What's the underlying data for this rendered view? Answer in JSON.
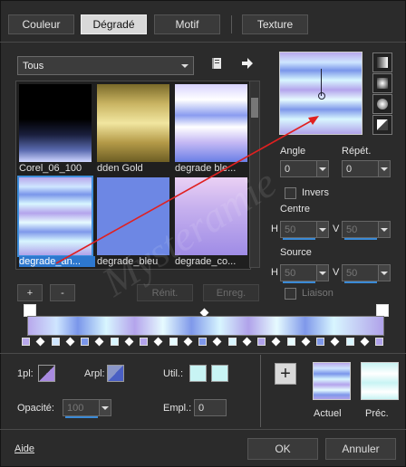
{
  "tabs": [
    "Couleur",
    "Dégradé",
    "Motif",
    "Texture"
  ],
  "active_tab": 1,
  "filter_value": "Tous",
  "thumbnails": [
    {
      "label": "Corel_06_100"
    },
    {
      "label": "dden Gold"
    },
    {
      "label": "degrade ble..."
    },
    {
      "label": "degrade_an..."
    },
    {
      "label": "degrade_bleu"
    },
    {
      "label": "degrade_co..."
    }
  ],
  "selected_thumbnail": "degrade_an...",
  "buttons": {
    "add": "+",
    "remove": "-",
    "reset": "Rénit.",
    "save": "Enreg.",
    "ok": "OK",
    "cancel": "Annuler",
    "help": "Aide"
  },
  "angle": {
    "label": "Angle",
    "value": "0"
  },
  "repeat": {
    "label": "Répét.",
    "value": "0"
  },
  "invert": {
    "label": "Invers",
    "checked": false
  },
  "center": {
    "label": "Centre",
    "h_label": "H",
    "h_value": "50",
    "v_label": "V",
    "v_value": "50"
  },
  "source": {
    "label": "Source",
    "h_label": "H",
    "h_value": "50",
    "v_label": "V",
    "v_value": "50"
  },
  "link": {
    "label": "Liaison",
    "checked": false
  },
  "opacity": {
    "label": "Opacité:",
    "value": "100"
  },
  "location": {
    "label": "Empl.:",
    "value": "0"
  },
  "color_labels": {
    "fg": "1pl:",
    "bg": "Arpl:",
    "user": "Util.:"
  },
  "result": {
    "current_label": "Actuel",
    "previous_label": "Préc."
  },
  "watermark": "Mysteramie",
  "colors": {
    "accent": "#2d78cf",
    "lavender": "#b8a8ec",
    "blue": "#7090e8",
    "light_cyan": "#c8f4f4",
    "red_arrow": "#e02020"
  }
}
